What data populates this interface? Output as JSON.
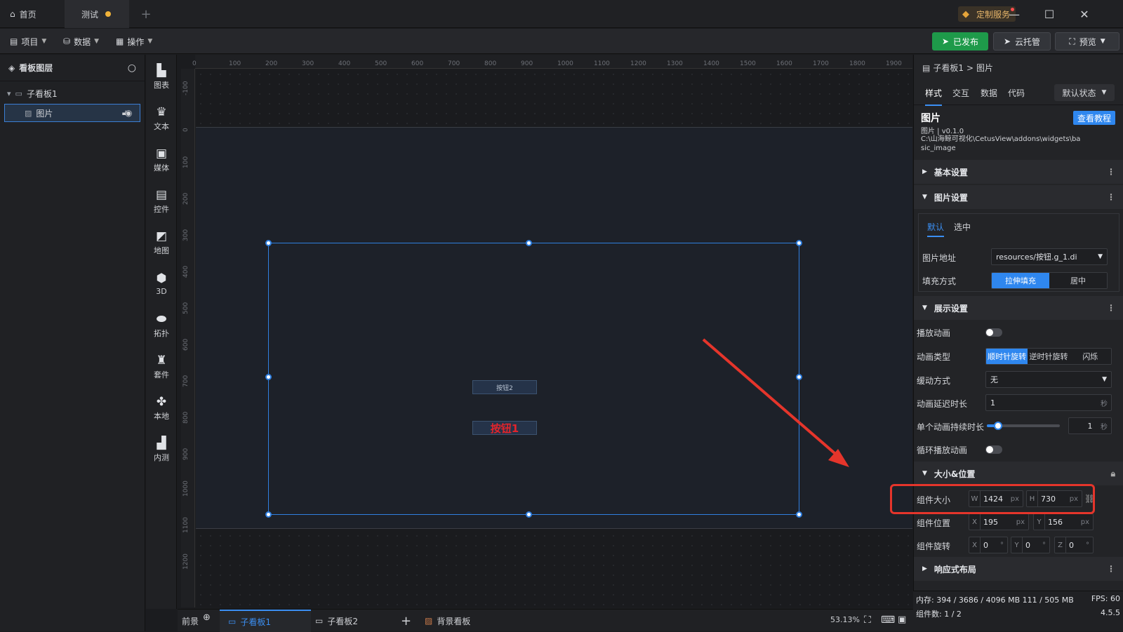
{
  "titlebar": {
    "home_tab": "首页",
    "test_tab": "测试",
    "custom_service": "定制服务"
  },
  "menubar": {
    "project": "项目",
    "data": "数据",
    "operation": "操作",
    "published": "已发布",
    "cloud_host": "云托管",
    "preview": "预览"
  },
  "layers": {
    "title": "看板图层",
    "items": [
      {
        "label": "子看板1"
      },
      {
        "label": "图片"
      }
    ]
  },
  "toolbox": [
    {
      "label": "图表",
      "icon": "chart-icon"
    },
    {
      "label": "文本",
      "icon": "text-icon"
    },
    {
      "label": "媒体",
      "icon": "media-icon"
    },
    {
      "label": "控件",
      "icon": "control-icon"
    },
    {
      "label": "地图",
      "icon": "map-icon"
    },
    {
      "label": "3D",
      "icon": "cube-icon"
    },
    {
      "label": "拓扑",
      "icon": "topology-icon"
    },
    {
      "label": "套件",
      "icon": "suite-icon"
    },
    {
      "label": "本地",
      "icon": "puzzle-icon"
    },
    {
      "label": "内测",
      "icon": "beta-icon"
    }
  ],
  "ruler": {
    "h": [
      "0",
      "100",
      "200",
      "300",
      "400",
      "500",
      "600",
      "700",
      "800",
      "900",
      "1000",
      "1100",
      "1200",
      "1300",
      "1400",
      "1500",
      "1600",
      "1700",
      "1800",
      "1900"
    ],
    "v": [
      "-100",
      "0",
      "100",
      "200",
      "300",
      "400",
      "500",
      "600",
      "700",
      "800",
      "900",
      "1000",
      "1100",
      "1200"
    ]
  },
  "canvas": {
    "button2": "按钮2",
    "button1": "按钮1"
  },
  "bottom": {
    "foreground": "前景",
    "sub1": "子看板1",
    "sub2": "子看板2",
    "background": "背景看板",
    "zoom": "53.13%"
  },
  "props": {
    "breadcrumb_parent": "子看板1",
    "breadcrumb_sep": ">",
    "breadcrumb_current": "图片",
    "tabs": [
      "样式",
      "交互",
      "数据",
      "代码"
    ],
    "state": "默认状态",
    "widget_name": "图片",
    "widget_version": "图片 | v0.1.0",
    "widget_path": "C:\\山海鲸可视化\\CetusView\\addons\\widgets\\basic_image",
    "tutorial": "查看教程",
    "basic_settings": "基本设置",
    "image_settings": "图片设置",
    "img_tabs": [
      "默认",
      "选中"
    ],
    "img_url_label": "图片地址",
    "img_url": "resources/按钮.g_1.di",
    "fill_label": "填充方式",
    "fill_options": [
      "拉伸填充",
      "居中"
    ],
    "display_settings": "展示设置",
    "play_anim": "播放动画",
    "anim_type": "动画类型",
    "anim_types": [
      "顺时针旋转",
      "逆时针旋转",
      "闪烁"
    ],
    "easing": "缓动方式",
    "easing_value": "无",
    "delay": "动画延迟时长",
    "delay_value": "1",
    "sec": "秒",
    "duration": "单个动画持续时长",
    "duration_value": "1",
    "duration_fraction": 0.15,
    "loop": "循环播放动画",
    "size_pos": "大小&位置",
    "size_label": "组件大小",
    "w": "1424",
    "h": "730",
    "px": "px",
    "pos_label": "组件位置",
    "x": "195",
    "y": "156",
    "rot_label": "组件旋转",
    "rx": "0",
    "ry": "0",
    "rz": "0",
    "deg": "°",
    "responsive": "响应式布局"
  },
  "status": {
    "memory": "内存: 394 / 3686 / 4096 MB  111 / 505 MB",
    "fps": "FPS: 60",
    "count": "组件数: 1 / 2",
    "version": "4.5.5"
  }
}
